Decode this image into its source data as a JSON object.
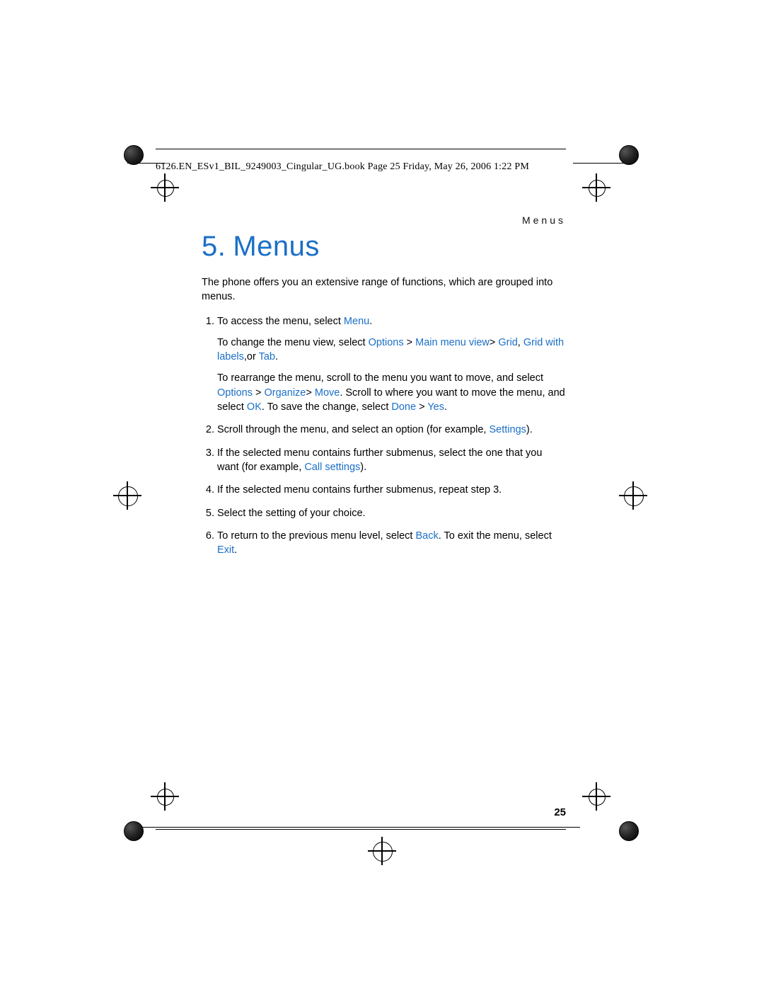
{
  "book_header": "6126.EN_ESv1_BIL_9249003_Cingular_UG.book  Page 25  Friday, May 26, 2006  1:22 PM",
  "section_header": "Menus",
  "chapter_number": "5.",
  "chapter_title": "Menus",
  "intro": "The phone offers you an extensive range of functions, which are grouped into menus.",
  "steps": {
    "s1": {
      "a1": "To access the menu, select ",
      "a2": "Menu",
      "a3": ".",
      "b1": "To change the menu view, select ",
      "b2": "Options",
      "b3": " > ",
      "b4": "Main menu view",
      "b5": "> ",
      "b6": "Grid",
      "b7": ", ",
      "b8": "Grid with labels",
      "b9": ",or ",
      "b10": "Tab",
      "b11": ".",
      "c1": "To rearrange the menu, scroll to the menu you want to move, and select ",
      "c2": "Options",
      "c3": " > ",
      "c4": "Organize",
      "c5": "> ",
      "c6": "Move",
      "c7": ". Scroll to where you want to move the menu, and select ",
      "c8": "OK",
      "c9": ". To save the change, select ",
      "c10": "Done",
      "c11": " > ",
      "c12": "Yes",
      "c13": "."
    },
    "s2": {
      "a1": "Scroll through the menu, and select an option (for example, ",
      "a2": "Settings",
      "a3": ")."
    },
    "s3": {
      "a1": "If the selected menu contains further submenus, select the one that you want (for example, ",
      "a2": "Call settings",
      "a3": ")."
    },
    "s4": "If the selected menu contains further submenus, repeat step 3.",
    "s5": "Select the setting of your choice.",
    "s6": {
      "a1": "To return to the previous menu level, select ",
      "a2": "Back",
      "a3": ". To exit the menu, select ",
      "a4": "Exit",
      "a5": "."
    }
  },
  "page_number": "25"
}
